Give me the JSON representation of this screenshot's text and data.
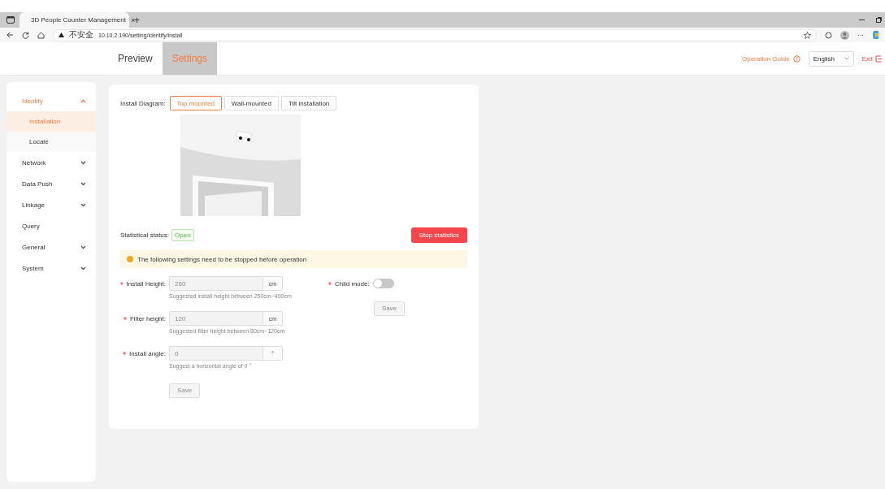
{
  "browser": {
    "tab_title": "3D People Counter Management",
    "tab_close": "×",
    "new_tab": "+",
    "security": "不安全",
    "url": "10.10.2.190/setting/identify/install",
    "more": "···"
  },
  "header": {
    "nav_tabs": [
      {
        "label": "Preview",
        "selected": false
      },
      {
        "label": "Settings",
        "selected": true
      }
    ],
    "operation_guide": "Operation Guide",
    "language": "English",
    "exit": "Exit"
  },
  "sidebar": {
    "items": [
      {
        "label": "Identify",
        "expandable": true,
        "expanded": true,
        "selected": false,
        "children": [
          {
            "label": "Installation",
            "selected": true
          },
          {
            "label": "Locale",
            "selected": false
          }
        ]
      },
      {
        "label": "Network",
        "expandable": true,
        "expanded": false,
        "selected": false
      },
      {
        "label": "Data Push",
        "expandable": true,
        "expanded": false,
        "selected": false
      },
      {
        "label": "Linkage",
        "expandable": true,
        "expanded": false,
        "selected": false
      },
      {
        "label": "Query",
        "expandable": false,
        "expanded": false,
        "selected": false
      },
      {
        "label": "General",
        "expandable": true,
        "expanded": false,
        "selected": false
      },
      {
        "label": "System",
        "expandable": true,
        "expanded": false,
        "selected": false
      }
    ]
  },
  "install_diagram": {
    "label": "Install Diagram:",
    "options": [
      {
        "label": "Top mounted",
        "selected": true
      },
      {
        "label": "Wall-mounted",
        "selected": false
      },
      {
        "label": "Tilt installation",
        "selected": false
      }
    ]
  },
  "status": {
    "label": "Statistical status:",
    "badge": "Open",
    "stop_button": "Stop statistics"
  },
  "alert": "The following settings need to be stopped before operation",
  "fields": [
    {
      "label": "Install Height:",
      "required": true,
      "value": "260",
      "unit": "cm",
      "hint": "Suggested install height between 250cm~400cm",
      "disabled": true
    },
    {
      "label": "Filter height:",
      "required": true,
      "value": "120",
      "unit": "cm",
      "hint": "Suggested filter height between 80cm~120cm",
      "disabled": true
    },
    {
      "label": "Install angle:",
      "required": true,
      "value": "0",
      "unit": "°",
      "hint": "Suggest a horizontal angle of 0 °",
      "disabled": true
    }
  ],
  "save_button": {
    "label": "Save",
    "disabled": true
  },
  "child_mode": {
    "label": "Child mode:",
    "required": true,
    "on": false,
    "save_label": "Save",
    "save_disabled": true
  }
}
